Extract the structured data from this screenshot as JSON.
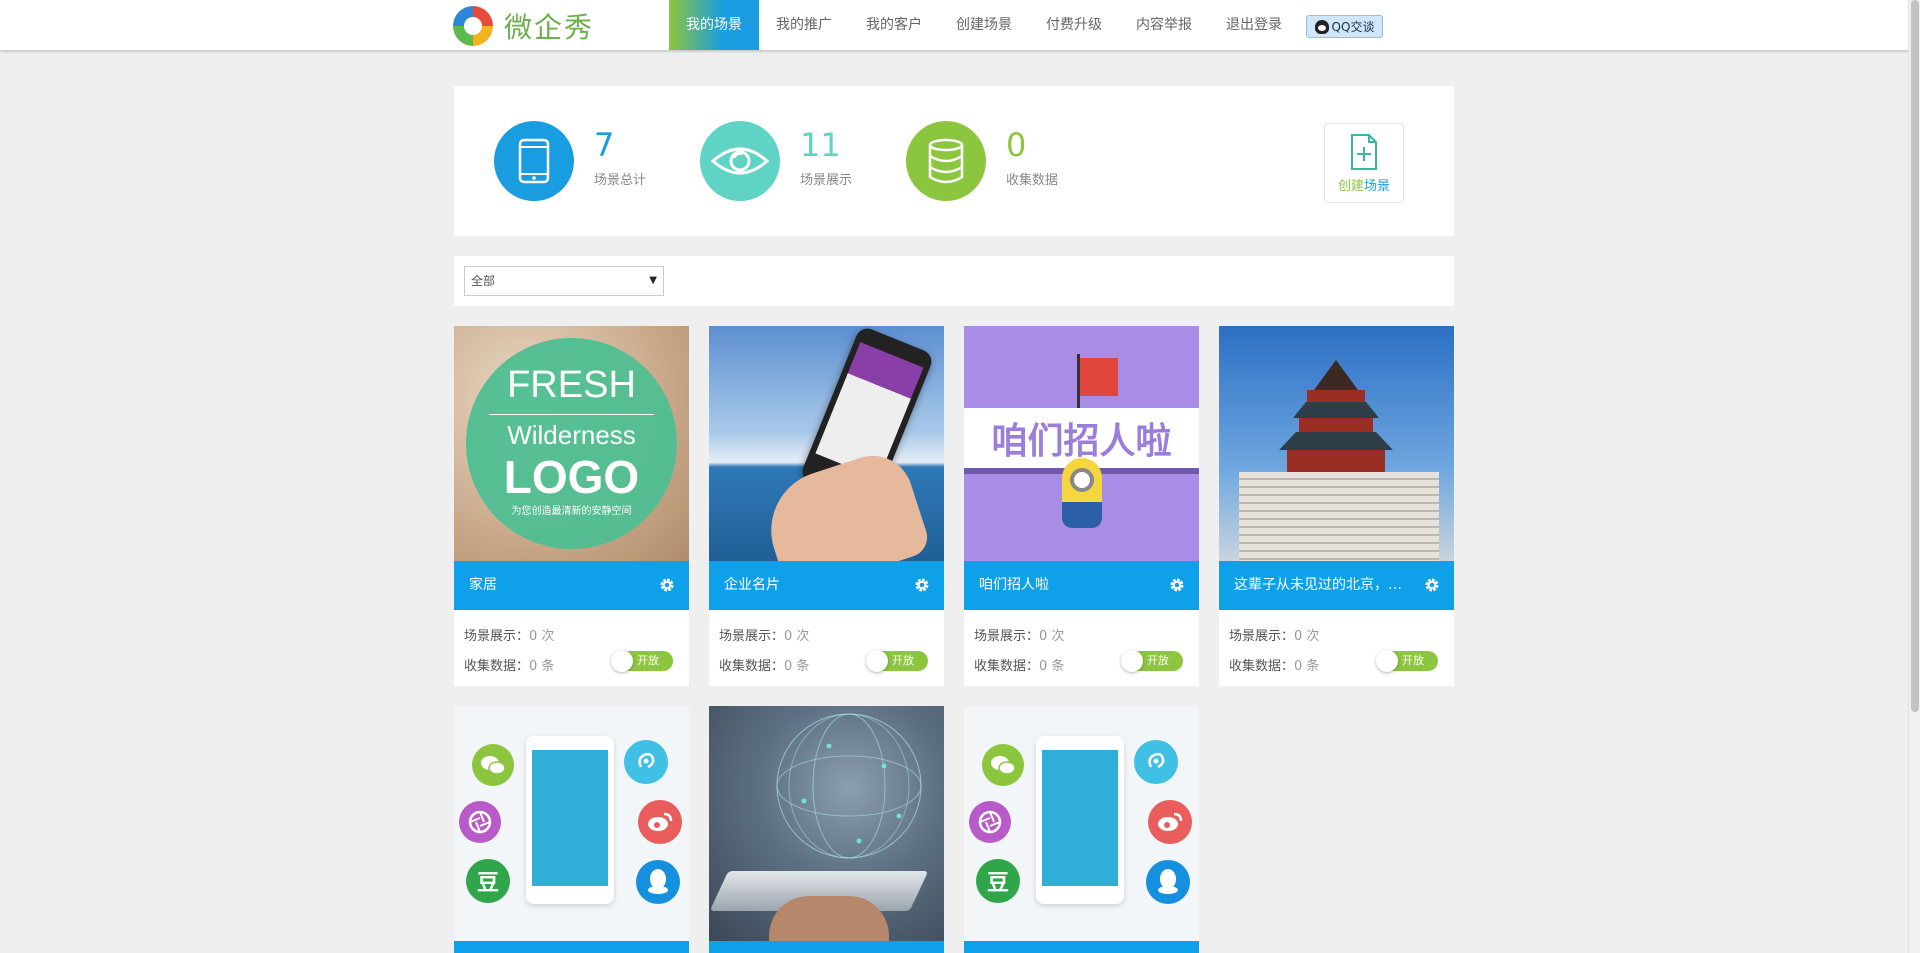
{
  "header": {
    "brand": "微企秀",
    "nav": [
      {
        "label": "我的场景",
        "active": true
      },
      {
        "label": "我的推广",
        "active": false
      },
      {
        "label": "我的客户",
        "active": false
      },
      {
        "label": "创建场景",
        "active": false
      },
      {
        "label": "付费升级",
        "active": false
      },
      {
        "label": "内容举报",
        "active": false
      },
      {
        "label": "退出登录",
        "active": false
      }
    ],
    "qq_button": "QQ交谈"
  },
  "stats": {
    "scenes": {
      "value": "7",
      "label": "场景总计",
      "icon": "phone-icon",
      "color": "#1a9de0"
    },
    "views": {
      "value": "11",
      "label": "场景展示",
      "icon": "eye-icon",
      "color": "#5fd3c4"
    },
    "data": {
      "value": "0",
      "label": "收集数据",
      "icon": "database-icon",
      "color": "#8cc63f"
    },
    "create": {
      "label_green": "创建",
      "label_blue": "场景"
    }
  },
  "filter": {
    "selected": "全部"
  },
  "card_labels": {
    "views": "场景展示：",
    "data": "收集数据：",
    "toggle": "开放"
  },
  "thumb_text": {
    "fresh": "FRESH",
    "wilderness": "Wilderness",
    "logo": "LOGO",
    "slogan": "为您创造最清新的安静空间",
    "recruit": "咱们招人啦",
    "dou": "豆"
  },
  "cards": [
    {
      "title": "家居",
      "views": "0 次",
      "data": "0 条"
    },
    {
      "title": "企业名片",
      "views": "0 次",
      "data": "0 条"
    },
    {
      "title": "咱们招人啦",
      "views": "0 次",
      "data": "0 条"
    },
    {
      "title": "这辈子从未见过的北京，你一定要看",
      "views": "0 次",
      "data": "0 条"
    },
    {
      "title": "",
      "views": "",
      "data": ""
    },
    {
      "title": "",
      "views": "",
      "data": ""
    },
    {
      "title": "",
      "views": "",
      "data": ""
    }
  ],
  "colors": {
    "accent": "#0fa0ea",
    "green": "#8cc63f",
    "teal": "#5fd3c4"
  }
}
